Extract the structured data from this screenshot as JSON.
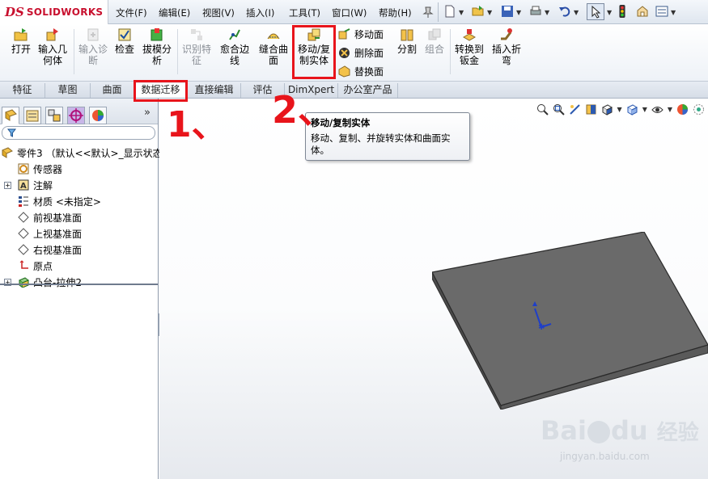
{
  "app": {
    "logo_ds": "DS",
    "logo_text": "SOLIDWORKS",
    "brand_color": "#c8102e"
  },
  "menu": {
    "items": [
      "文件(F)",
      "编辑(E)",
      "视图(V)",
      "插入(I)",
      "工具(T)",
      "窗口(W)",
      "帮助(H)"
    ]
  },
  "ribbon": {
    "tools": [
      {
        "label_l1": "打开",
        "label_l2": "",
        "icon": "open-folder-icon",
        "enabled": true
      },
      {
        "label_l1": "输入几",
        "label_l2": "何体",
        "icon": "import-geometry-icon",
        "enabled": true
      },
      {
        "label_l1": "输入诊",
        "label_l2": "断",
        "icon": "import-diagnostics-icon",
        "enabled": false
      },
      {
        "label_l1": "检查",
        "label_l2": "",
        "icon": "check-icon",
        "enabled": true
      },
      {
        "label_l1": "拔模分",
        "label_l2": "析",
        "icon": "draft-analysis-icon",
        "enabled": true
      },
      {
        "label_l1": "识别特",
        "label_l2": "征",
        "icon": "feature-recognition-icon",
        "enabled": false
      },
      {
        "label_l1": "愈合边",
        "label_l2": "线",
        "icon": "heal-edges-icon",
        "enabled": true
      },
      {
        "label_l1": "缝合曲",
        "label_l2": "面",
        "icon": "knit-surface-icon",
        "enabled": true
      },
      {
        "label_l1": "移动/复",
        "label_l2": "制实体",
        "icon": "move-copy-body-icon",
        "enabled": true
      },
      {
        "label_l1": "分割",
        "label_l2": "",
        "icon": "split-icon",
        "enabled": true
      },
      {
        "label_l1": "组合",
        "label_l2": "",
        "icon": "combine-icon",
        "enabled": false
      },
      {
        "label_l1": "转换到",
        "label_l2": "钣金",
        "icon": "convert-sheet-metal-icon",
        "enabled": true
      },
      {
        "label_l1": "插入折",
        "label_l2": "弯",
        "icon": "insert-bends-icon",
        "enabled": true
      }
    ],
    "small_tools": [
      {
        "label": "移动面",
        "icon": "move-face-icon"
      },
      {
        "label": "删除面",
        "icon": "delete-face-icon"
      },
      {
        "label": "替换面",
        "icon": "replace-face-icon"
      }
    ]
  },
  "tabs": [
    "特征",
    "草图",
    "曲面",
    "数据迁移",
    "直接编辑",
    "评估",
    "DimXpert",
    "办公室产品"
  ],
  "active_tab": "数据迁移",
  "tree": {
    "nodes": [
      {
        "label": "零件3 （默认<<默认>_显示状态",
        "icon": "part-icon",
        "indent": 0,
        "expander": ""
      },
      {
        "label": "传感器",
        "icon": "sensor-icon",
        "indent": 1,
        "expander": ""
      },
      {
        "label": "注解",
        "icon": "annotation-icon",
        "indent": 1,
        "expander": "+"
      },
      {
        "label": "材质 <未指定>",
        "icon": "material-icon",
        "indent": 1,
        "expander": ""
      },
      {
        "label": "前视基准面",
        "icon": "plane-icon",
        "indent": 1,
        "expander": ""
      },
      {
        "label": "上视基准面",
        "icon": "plane-icon",
        "indent": 1,
        "expander": ""
      },
      {
        "label": "右视基准面",
        "icon": "plane-icon",
        "indent": 1,
        "expander": ""
      },
      {
        "label": "原点",
        "icon": "origin-icon",
        "indent": 1,
        "expander": ""
      },
      {
        "label": "凸台-拉伸2",
        "icon": "extrude-icon",
        "indent": 1,
        "expander": "+"
      }
    ]
  },
  "tooltip": {
    "title": "移动/复制实体",
    "body": "移动、复制、并旋转实体和曲面实体。"
  },
  "annotations": {
    "step1": "1、",
    "step2": "2、",
    "color": "#e8141b"
  },
  "watermark": {
    "brand": "Bai",
    "brand2": "du",
    "jingyan": "经验",
    "url": "jingyan.baidu.com"
  }
}
